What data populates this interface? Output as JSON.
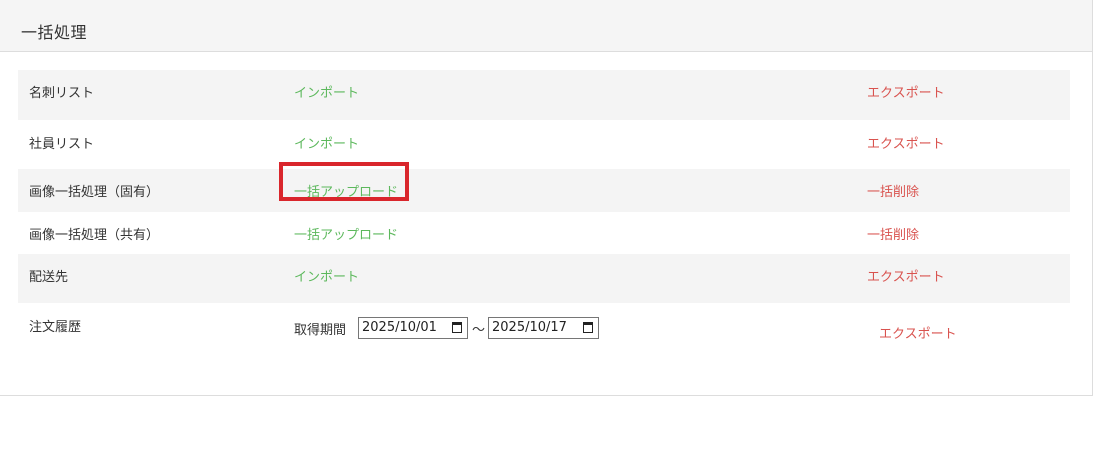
{
  "panel": {
    "title": "一括処理"
  },
  "rows": [
    {
      "label": "名刺リスト",
      "action": "インポート",
      "export": "エクスポート"
    },
    {
      "label": "社員リスト",
      "action": "インポート",
      "export": "エクスポート"
    },
    {
      "label": "画像一括処理（固有）",
      "action": "一括アップロード",
      "export": "一括削除"
    },
    {
      "label": "画像一括処理（共有）",
      "action": "一括アップロード",
      "export": "一括削除"
    },
    {
      "label": "配送先",
      "action": "インポート",
      "export": "エクスポート"
    }
  ],
  "order_history": {
    "label": "注文履歴",
    "period_label": "取得期間",
    "start_date": "2025/10/01",
    "separator": "〜",
    "end_date": "2025/10/17",
    "export": "エクスポート"
  },
  "colors": {
    "import_green": "#5cb85c",
    "export_red": "#d9534f",
    "highlight_red": "#d9262c",
    "stripe": "#f4f4f4"
  }
}
